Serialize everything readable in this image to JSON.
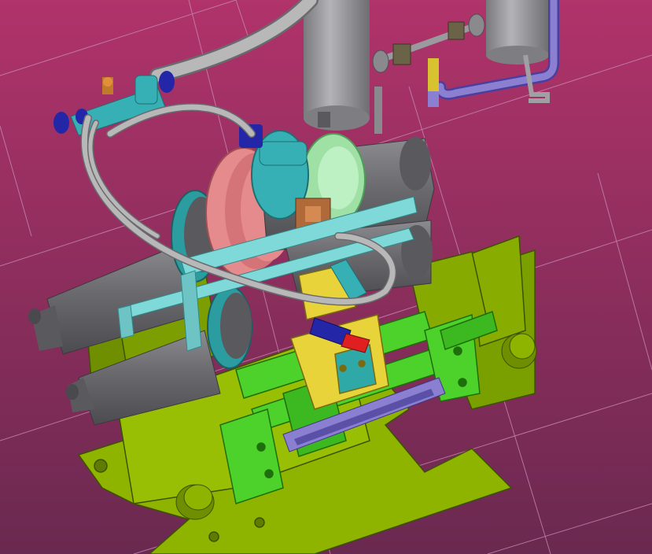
{
  "viewport": {
    "background_top": "#b0336a",
    "background_bottom": "#6a2950",
    "grid_color": "#c98fb8"
  },
  "colors": {
    "body_gray": "#6e6e72",
    "body_gray_light": "#9a9a9e",
    "frame_olive": "#8fb400",
    "frame_olive_dark": "#5f7c00",
    "bracket_green": "#4cd22a",
    "bracket_green_dark": "#2f9a16",
    "pulley_pink": "#e68b8d",
    "teal": "#36b0b4",
    "light_green": "#9fe0a5",
    "cyan_bar": "#7fd9d9",
    "hose": "#b8b8b8",
    "navy": "#2426a8",
    "purple_pipe": "#8b7fd2",
    "yellow": "#e8d43a",
    "red": "#e02020",
    "slot_violet": "#8a7fd0"
  }
}
